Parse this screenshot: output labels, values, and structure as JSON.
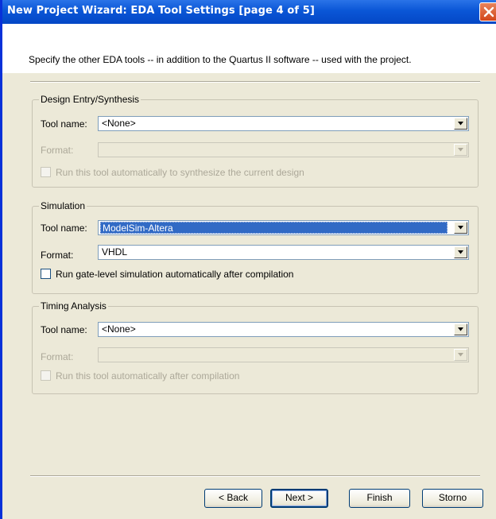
{
  "window": {
    "title": "New Project Wizard: EDA Tool Settings [page 4 of 5]",
    "close_icon": "close-icon",
    "accent_color": "#0447c6",
    "close_color": "#d3461a"
  },
  "header": {
    "description": "Specify the other EDA tools -- in addition to the Quartus II software -- used with the project."
  },
  "groups": {
    "design_entry": {
      "title": "Design Entry/Synthesis",
      "tool_name_label": "Tool name:",
      "tool_name_value": "<None>",
      "format_label": "Format:",
      "format_value": "",
      "checkbox_label": "Run this tool automatically to synthesize the current design",
      "checkbox_checked": false,
      "format_enabled": false
    },
    "simulation": {
      "title": "Simulation",
      "tool_name_label": "Tool name:",
      "tool_name_value": "ModelSim-Altera",
      "format_label": "Format:",
      "format_value": "VHDL",
      "checkbox_label": "Run gate-level simulation automatically after compilation",
      "checkbox_checked": false,
      "format_enabled": true
    },
    "timing": {
      "title": "Timing Analysis",
      "tool_name_label": "Tool name:",
      "tool_name_value": "<None>",
      "format_label": "Format:",
      "format_value": "",
      "checkbox_label": "Run this tool automatically after compilation",
      "checkbox_checked": false,
      "format_enabled": false
    }
  },
  "buttons": {
    "back": "< Back",
    "next": "Next >",
    "finish": "Finish",
    "cancel": "Storno"
  },
  "icons": {
    "dropdown": "chevron-down-icon"
  }
}
